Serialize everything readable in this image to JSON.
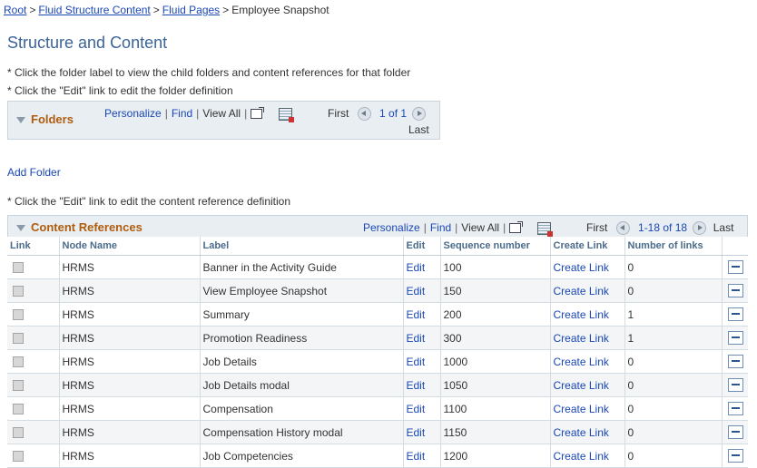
{
  "breadcrumb": {
    "items": [
      "Root",
      "Fluid Structure Content",
      "Fluid Pages"
    ],
    "current": "Employee Snapshot",
    "separator": ">"
  },
  "page_title": "Structure and Content",
  "notes": {
    "folder_click": "* Click the folder label to view the child folders and content references for that folder",
    "folder_edit": "* Click the \"Edit\" link to edit the folder definition",
    "cref_edit": "* Click the \"Edit\" link to edit the content reference definition"
  },
  "folders_grid": {
    "title": "Folders",
    "personalize": "Personalize",
    "find": "Find",
    "view_all": "View All",
    "first": "First",
    "range": "1 of 1",
    "last": "Last"
  },
  "add_folder": "Add Folder",
  "cref_grid": {
    "title": "Content References",
    "personalize": "Personalize",
    "find": "Find",
    "view_all": "View All",
    "first": "First",
    "range": "1-18 of 18",
    "last": "Last",
    "columns": [
      "Link",
      "Node Name",
      "Label",
      "Edit",
      "Sequence number",
      "Create Link",
      "Number of links"
    ],
    "rows": [
      {
        "node": "HRMS",
        "label": "Banner in the Activity Guide",
        "edit": "Edit",
        "seq": "100",
        "create": "Create Link",
        "links": "0"
      },
      {
        "node": "HRMS",
        "label": "View Employee Snapshot",
        "edit": "Edit",
        "seq": "150",
        "create": "Create Link",
        "links": "0"
      },
      {
        "node": "HRMS",
        "label": "Summary",
        "edit": "Edit",
        "seq": "200",
        "create": "Create Link",
        "links": "1"
      },
      {
        "node": "HRMS",
        "label": "Promotion Readiness",
        "edit": "Edit",
        "seq": "300",
        "create": "Create Link",
        "links": "1"
      },
      {
        "node": "HRMS",
        "label": "Job Details",
        "edit": "Edit",
        "seq": "1000",
        "create": "Create Link",
        "links": "0"
      },
      {
        "node": "HRMS",
        "label": "Job Details modal",
        "edit": "Edit",
        "seq": "1050",
        "create": "Create Link",
        "links": "0"
      },
      {
        "node": "HRMS",
        "label": "Compensation",
        "edit": "Edit",
        "seq": "1100",
        "create": "Create Link",
        "links": "0"
      },
      {
        "node": "HRMS",
        "label": "Compensation History modal",
        "edit": "Edit",
        "seq": "1150",
        "create": "Create Link",
        "links": "0"
      },
      {
        "node": "HRMS",
        "label": "Job Competencies",
        "edit": "Edit",
        "seq": "1200",
        "create": "Create Link",
        "links": "0"
      }
    ]
  }
}
